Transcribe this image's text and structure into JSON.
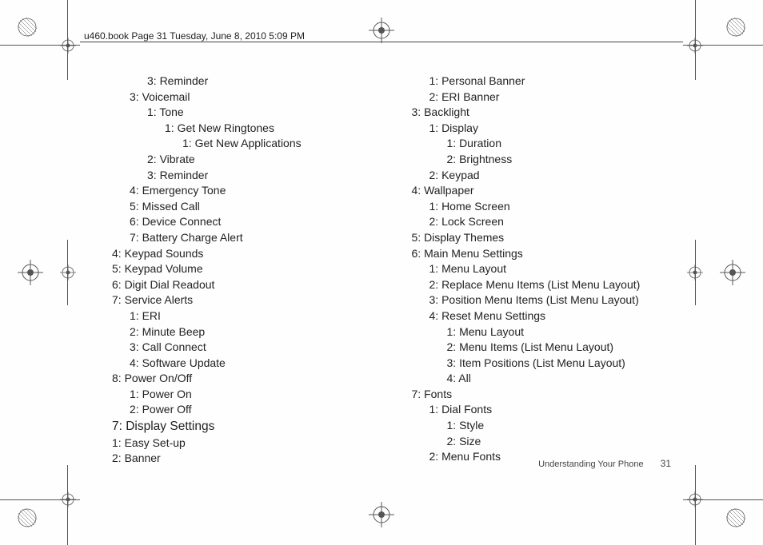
{
  "header": "u460.book  Page 31  Tuesday, June 8, 2010  5:09 PM",
  "footer": {
    "section": "Understanding Your Phone",
    "page": "31"
  },
  "col1": [
    {
      "lvl": 2,
      "t": "3: Reminder"
    },
    {
      "lvl": 1,
      "t": "3: Voicemail"
    },
    {
      "lvl": 2,
      "t": "1: Tone"
    },
    {
      "lvl": 3,
      "t": "1: Get New Ringtones"
    },
    {
      "lvl": 4,
      "t": "1: Get New Applications"
    },
    {
      "lvl": 2,
      "t": "2: Vibrate"
    },
    {
      "lvl": 2,
      "t": "3: Reminder"
    },
    {
      "lvl": 1,
      "t": "4: Emergency Tone"
    },
    {
      "lvl": 1,
      "t": "5: Missed Call"
    },
    {
      "lvl": 1,
      "t": "6: Device Connect"
    },
    {
      "lvl": 1,
      "t": "7: Battery Charge Alert"
    },
    {
      "lvl": 0,
      "t": "4: Keypad Sounds"
    },
    {
      "lvl": 0,
      "t": "5: Keypad Volume"
    },
    {
      "lvl": 0,
      "t": "6: Digit Dial Readout"
    },
    {
      "lvl": 0,
      "t": "7: Service Alerts"
    },
    {
      "lvl": 1,
      "t": "1: ERI"
    },
    {
      "lvl": 1,
      "t": "2: Minute Beep"
    },
    {
      "lvl": 1,
      "t": "3: Call Connect"
    },
    {
      "lvl": 1,
      "t": "4: Software Update"
    },
    {
      "lvl": 0,
      "t": "8: Power On/Off"
    },
    {
      "lvl": 1,
      "t": "1: Power On"
    },
    {
      "lvl": 1,
      "t": "2: Power Off"
    },
    {
      "lvl": -1,
      "t": "7: Display Settings",
      "section": true
    },
    {
      "lvl": 0,
      "t": "1: Easy Set-up"
    },
    {
      "lvl": 0,
      "t": "2: Banner"
    }
  ],
  "col2": [
    {
      "lvl": 1,
      "t": "1: Personal Banner"
    },
    {
      "lvl": 1,
      "t": "2: ERI Banner"
    },
    {
      "lvl": 0,
      "t": "3: Backlight"
    },
    {
      "lvl": 1,
      "t": "1: Display"
    },
    {
      "lvl": 2,
      "t": "1: Duration"
    },
    {
      "lvl": 2,
      "t": "2: Brightness"
    },
    {
      "lvl": 1,
      "t": "2: Keypad"
    },
    {
      "lvl": 0,
      "t": "4: Wallpaper"
    },
    {
      "lvl": 1,
      "t": "1: Home Screen"
    },
    {
      "lvl": 1,
      "t": "2: Lock Screen"
    },
    {
      "lvl": 0,
      "t": "5: Display Themes"
    },
    {
      "lvl": 0,
      "t": "6: Main Menu Settings"
    },
    {
      "lvl": 1,
      "t": "1: Menu Layout"
    },
    {
      "lvl": 1,
      "t": "2: Replace Menu Items (List Menu Layout)"
    },
    {
      "lvl": 1,
      "t": "3: Position Menu Items (List Menu Layout)"
    },
    {
      "lvl": 1,
      "t": "4: Reset Menu Settings"
    },
    {
      "lvl": 2,
      "t": "1: Menu Layout"
    },
    {
      "lvl": 2,
      "t": "2: Menu Items (List Menu Layout)"
    },
    {
      "lvl": 2,
      "t": "3: Item Positions (List Menu Layout)"
    },
    {
      "lvl": 2,
      "t": "4: All"
    },
    {
      "lvl": 0,
      "t": "7: Fonts"
    },
    {
      "lvl": 1,
      "t": "1: Dial Fonts"
    },
    {
      "lvl": 2,
      "t": "1: Style"
    },
    {
      "lvl": 2,
      "t": "2: Size"
    },
    {
      "lvl": 1,
      "t": "2: Menu Fonts"
    }
  ]
}
